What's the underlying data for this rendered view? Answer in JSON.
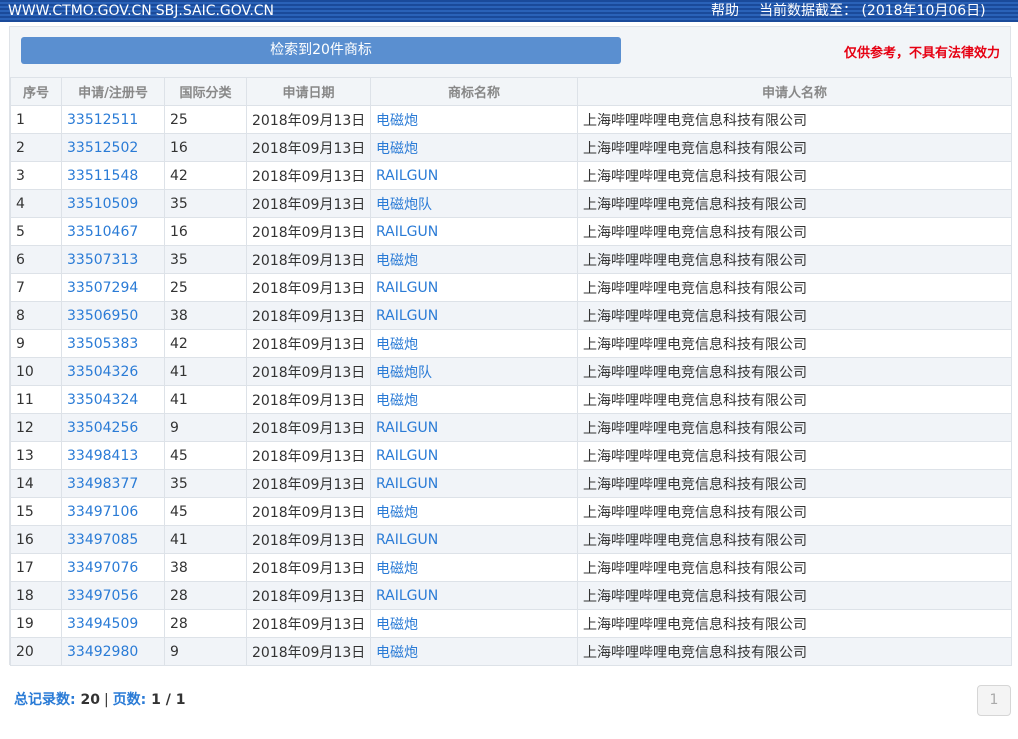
{
  "topbar": {
    "site1": "WWW.CTMO.GOV.CN",
    "site2": "SBJ.SAIC.GOV.CN",
    "help": "帮助",
    "cutoff": "当前数据截至： (2018年10月06日)"
  },
  "search": {
    "result_label": "检索到20件商标",
    "disclaimer": "仅供参考，不具有法律效力"
  },
  "table": {
    "headers": [
      "序号",
      "申请/注册号",
      "国际分类",
      "申请日期",
      "商标名称",
      "申请人名称"
    ],
    "rows": [
      {
        "no": "1",
        "reg": "33512511",
        "cls": "25",
        "date": "2018年09月13日",
        "mark": "电磁炮",
        "applicant": "上海哔哩哔哩电竞信息科技有限公司"
      },
      {
        "no": "2",
        "reg": "33512502",
        "cls": "16",
        "date": "2018年09月13日",
        "mark": "电磁炮",
        "applicant": "上海哔哩哔哩电竞信息科技有限公司"
      },
      {
        "no": "3",
        "reg": "33511548",
        "cls": "42",
        "date": "2018年09月13日",
        "mark": "RAILGUN",
        "applicant": "上海哔哩哔哩电竞信息科技有限公司"
      },
      {
        "no": "4",
        "reg": "33510509",
        "cls": "35",
        "date": "2018年09月13日",
        "mark": "电磁炮队",
        "applicant": "上海哔哩哔哩电竞信息科技有限公司"
      },
      {
        "no": "5",
        "reg": "33510467",
        "cls": "16",
        "date": "2018年09月13日",
        "mark": "RAILGUN",
        "applicant": "上海哔哩哔哩电竞信息科技有限公司"
      },
      {
        "no": "6",
        "reg": "33507313",
        "cls": "35",
        "date": "2018年09月13日",
        "mark": "电磁炮",
        "applicant": "上海哔哩哔哩电竞信息科技有限公司"
      },
      {
        "no": "7",
        "reg": "33507294",
        "cls": "25",
        "date": "2018年09月13日",
        "mark": "RAILGUN",
        "applicant": "上海哔哩哔哩电竞信息科技有限公司"
      },
      {
        "no": "8",
        "reg": "33506950",
        "cls": "38",
        "date": "2018年09月13日",
        "mark": "RAILGUN",
        "applicant": "上海哔哩哔哩电竞信息科技有限公司"
      },
      {
        "no": "9",
        "reg": "33505383",
        "cls": "42",
        "date": "2018年09月13日",
        "mark": "电磁炮",
        "applicant": "上海哔哩哔哩电竞信息科技有限公司"
      },
      {
        "no": "10",
        "reg": "33504326",
        "cls": "41",
        "date": "2018年09月13日",
        "mark": "电磁炮队",
        "applicant": "上海哔哩哔哩电竞信息科技有限公司"
      },
      {
        "no": "11",
        "reg": "33504324",
        "cls": "41",
        "date": "2018年09月13日",
        "mark": "电磁炮",
        "applicant": "上海哔哩哔哩电竞信息科技有限公司"
      },
      {
        "no": "12",
        "reg": "33504256",
        "cls": "9",
        "date": "2018年09月13日",
        "mark": "RAILGUN",
        "applicant": "上海哔哩哔哩电竞信息科技有限公司"
      },
      {
        "no": "13",
        "reg": "33498413",
        "cls": "45",
        "date": "2018年09月13日",
        "mark": "RAILGUN",
        "applicant": "上海哔哩哔哩电竞信息科技有限公司"
      },
      {
        "no": "14",
        "reg": "33498377",
        "cls": "35",
        "date": "2018年09月13日",
        "mark": "RAILGUN",
        "applicant": "上海哔哩哔哩电竞信息科技有限公司"
      },
      {
        "no": "15",
        "reg": "33497106",
        "cls": "45",
        "date": "2018年09月13日",
        "mark": "电磁炮",
        "applicant": "上海哔哩哔哩电竞信息科技有限公司"
      },
      {
        "no": "16",
        "reg": "33497085",
        "cls": "41",
        "date": "2018年09月13日",
        "mark": "RAILGUN",
        "applicant": "上海哔哩哔哩电竞信息科技有限公司"
      },
      {
        "no": "17",
        "reg": "33497076",
        "cls": "38",
        "date": "2018年09月13日",
        "mark": "电磁炮",
        "applicant": "上海哔哩哔哩电竞信息科技有限公司"
      },
      {
        "no": "18",
        "reg": "33497056",
        "cls": "28",
        "date": "2018年09月13日",
        "mark": "RAILGUN",
        "applicant": "上海哔哩哔哩电竞信息科技有限公司"
      },
      {
        "no": "19",
        "reg": "33494509",
        "cls": "28",
        "date": "2018年09月13日",
        "mark": "电磁炮",
        "applicant": "上海哔哩哔哩电竞信息科技有限公司"
      },
      {
        "no": "20",
        "reg": "33492980",
        "cls": "9",
        "date": "2018年09月13日",
        "mark": "电磁炮",
        "applicant": "上海哔哩哔哩电竞信息科技有限公司"
      }
    ]
  },
  "footer": {
    "total_label": "总记录数:",
    "total_value": "20",
    "pages_label": "页数:",
    "pages_value": "1 / 1",
    "current_page": "1"
  },
  "colors": {
    "link": "#2a7bd6",
    "disclaimer": "#e60012",
    "button": "#5a8fd0",
    "topbar": "#1a4a9a"
  }
}
